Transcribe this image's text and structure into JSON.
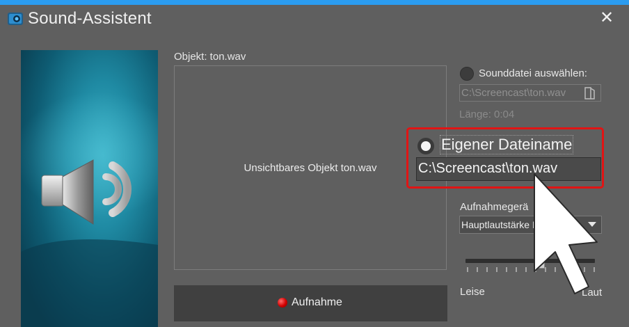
{
  "window": {
    "title": "Sound-Assistent",
    "close_label": "✕"
  },
  "preview": {
    "object_label": "Objekt: ton.wav",
    "content_text": "Unsichtbares Objekt  ton.wav"
  },
  "record": {
    "label": "Aufnahme"
  },
  "sound_file": {
    "radio_label": "Sounddatei auswählen:",
    "path": "C:\\Screencast\\ton.wav",
    "length": "Länge:  0:04"
  },
  "own_filename": {
    "radio_label": "Eigener Dateiname",
    "value": "C:\\Screencast\\ton.wav"
  },
  "recording_device": {
    "label": "Aufnahmegerä",
    "selected": "Hauptlautstärke Mikrof"
  },
  "volume": {
    "level": 0.57,
    "min_label": "Leise",
    "max_label": "Laut"
  },
  "colors": {
    "accent_top": "#2b9cf0",
    "highlight": "#e11414",
    "record_dot": "#d10000"
  }
}
